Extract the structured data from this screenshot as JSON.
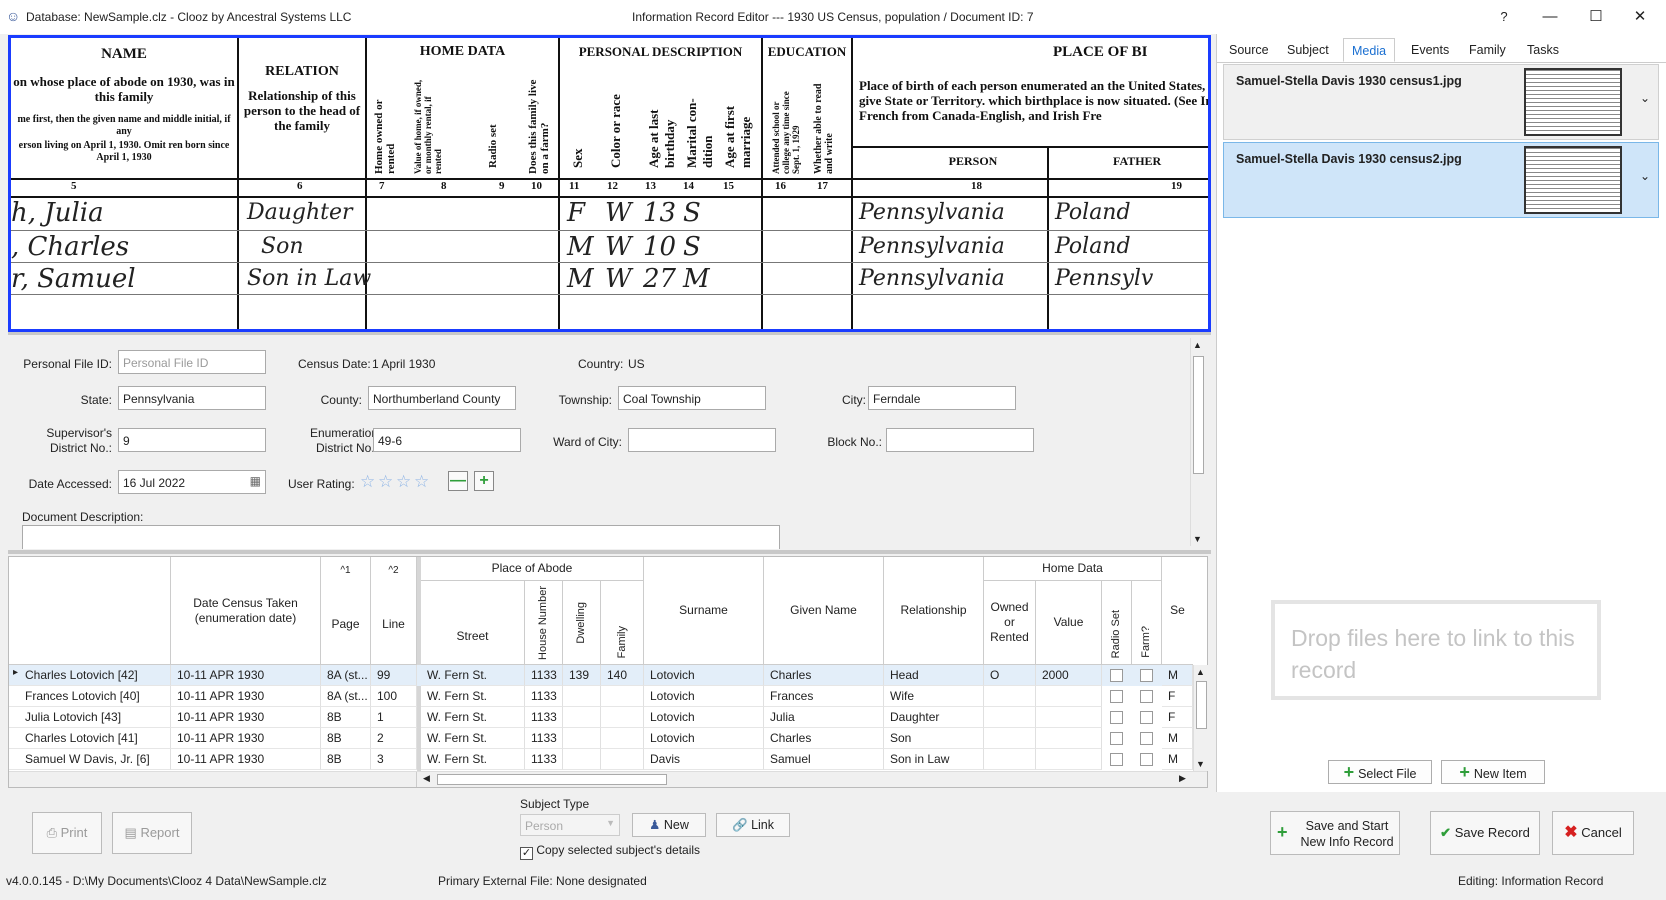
{
  "window": {
    "app_title": "Database: NewSample.clz - Clooz by Ancestral Systems LLC",
    "editor_title": "Information Record Editor --- 1930 US Census, population /  Document ID: 7",
    "help": "?",
    "minimize": "—",
    "maximize": "☐",
    "close": "✕"
  },
  "census_image": {
    "headers": [
      "NAME",
      "RELATION",
      "HOME DATA",
      "PERSONAL DESCRIPTION",
      "EDUCATION",
      "PLACE OF BI"
    ],
    "name_desc": "on whose place of abode on 1930, was in this family",
    "name_sub": "me first, then the given name and middle initial, if any",
    "name_sub2": "erson living on April 1, 1930. Omit ren born since April 1, 1930",
    "relation_desc": "Relationship of this person to the head of the family",
    "birth_desc": "Place of birth of each person enumerated an the United States, give State or Territory. which birthplace is now situated. (See In French from Canada-English, and Irish Fre",
    "home_cols": [
      "Home owned or rented",
      "Value of home, if owned, or monthly rental, if rented",
      "Radio set",
      "Does this family live on a farm?"
    ],
    "pd_cols": [
      "Sex",
      "Color or race",
      "Age at last birthday",
      "Marital con-dition",
      "Age at first marriage"
    ],
    "edu_cols": [
      "Attended school or college any time since Sept. 1, 1929",
      "Whether able to read and write"
    ],
    "person": "PERSON",
    "father": "FATHER",
    "col_nums": [
      "5",
      "6",
      "7",
      "8",
      "9",
      "10",
      "11",
      "12",
      "13",
      "14",
      "15",
      "16",
      "17",
      "18",
      "19"
    ],
    "hand_rows": [
      {
        "name": "h, Julia",
        "rel": "Daughter",
        "sex": "F",
        "race": "W",
        "age": "13",
        "mar": "S",
        "place": "Pennsylvania",
        "father": "Poland"
      },
      {
        "name": ", Charles",
        "rel": "Son",
        "sex": "M",
        "race": "W",
        "age": "10",
        "mar": "S",
        "place": "Pennsylvania",
        "father": "Poland"
      },
      {
        "name": "r, Samuel",
        "rel": "Son in Law",
        "sex": "M",
        "race": "W",
        "age": "27",
        "mar": "M",
        "place": "Pennsylvania",
        "father": "Pennsylv"
      }
    ]
  },
  "tabs": [
    "Source",
    "Subject",
    "Media",
    "Events",
    "Family",
    "Tasks"
  ],
  "media": [
    {
      "name": "Samuel-Stella Davis 1930 census1.jpg"
    },
    {
      "name": "Samuel-Stella Davis 1930 census2.jpg"
    }
  ],
  "drop_zone": "Drop files here to link to this record",
  "select_file": "Select File",
  "new_item": "New Item",
  "form": {
    "personal_file_id_label": "Personal File ID:",
    "personal_file_id_placeholder": "Personal File ID",
    "census_date_label": "Census Date:",
    "census_date": "1 April 1930",
    "country_label": "Country:",
    "country": "US",
    "state_label": "State:",
    "state": "Pennsylvania",
    "county_label": "County:",
    "county": "Northumberland County",
    "township_label": "Township:",
    "township": "Coal Township",
    "city_label": "City:",
    "city": "Ferndale",
    "supervisor_label": "Supervisor's District No.:",
    "supervisor": "9",
    "enum_label": "Enumeration District No.:",
    "enum": "49-6",
    "ward_label": "Ward of City:",
    "ward": "",
    "block_label": "Block No.:",
    "block": "",
    "date_accessed_label": "Date Accessed:",
    "date_accessed": "16 Jul 2022",
    "user_rating_label": "User Rating:",
    "user_rating": 0,
    "doc_desc_label": "Document Description:",
    "minus": "—",
    "plus": "+"
  },
  "grid": {
    "headers": {
      "date": "Date Census Taken (enumeration date)",
      "page": "Page",
      "line": "Line",
      "page_sort": "^1",
      "line_sort": "^2",
      "place_of_abode": "Place of Abode",
      "street": "Street",
      "house_number": "House Number",
      "dwelling": "Dwelling",
      "family": "Family",
      "surname": "Surname",
      "given_name": "Given Name",
      "relationship": "Relationship",
      "home_data": "Home Data",
      "owned": "Owned or Rented",
      "value": "Value",
      "radio": "Radio Set",
      "farm": "Farm?",
      "sex": "Se"
    },
    "rows": [
      {
        "subject": "Charles Lotovich  [42]",
        "date": "10-11 APR 1930",
        "page": "8A (st...",
        "line": "99",
        "street": "W. Fern St.",
        "house": "1133",
        "dwelling": "139",
        "family": "140",
        "surname": "Lotovich",
        "given": "Charles",
        "rel": "Head",
        "owned": "O",
        "value": "2000",
        "sex": "M"
      },
      {
        "subject": "Frances Lotovich  [40]",
        "date": "10-11 APR 1930",
        "page": "8A (st...",
        "line": "100",
        "street": "W. Fern St.",
        "house": "1133",
        "dwelling": "",
        "family": "",
        "surname": "Lotovich",
        "given": "Frances",
        "rel": "Wife",
        "owned": "",
        "value": "",
        "sex": "F"
      },
      {
        "subject": "Julia Lotovich  [43]",
        "date": "10-11 APR 1930",
        "page": "8B",
        "line": "1",
        "street": "W. Fern St.",
        "house": "1133",
        "dwelling": "",
        "family": "",
        "surname": "Lotovich",
        "given": "Julia",
        "rel": "Daughter",
        "owned": "",
        "value": "",
        "sex": "F"
      },
      {
        "subject": "Charles Lotovich  [41]",
        "date": "10-11 APR 1930",
        "page": "8B",
        "line": "2",
        "street": "W. Fern St.",
        "house": "1133",
        "dwelling": "",
        "family": "",
        "surname": "Lotovich",
        "given": "Charles",
        "rel": "Son",
        "owned": "",
        "value": "",
        "sex": "M"
      },
      {
        "subject": "Samuel W Davis, Jr.  [6]",
        "date": "10-11 APR 1930",
        "page": "8B",
        "line": "3",
        "street": "W. Fern St.",
        "house": "1133",
        "dwelling": "",
        "family": "",
        "surname": "Davis",
        "given": "Samuel",
        "rel": "Son in Law",
        "owned": "",
        "value": "",
        "sex": "M"
      }
    ]
  },
  "bottom": {
    "print": "Print",
    "report": "Report",
    "subject_type_label": "Subject Type",
    "subject_type": "Person",
    "new": "New",
    "link": "Link",
    "copy_details": "Copy selected subject's details",
    "save_start_1": "Save and Start",
    "save_start_2": "New Info Record",
    "save_record": "Save Record",
    "cancel": "Cancel"
  },
  "status": {
    "version_path": "v4.0.0.145  -  D:\\My Documents\\Clooz 4 Data\\NewSample.clz",
    "primary_external": "Primary External File: None designated",
    "editing": "Editing: Information Record"
  },
  "colors": {
    "accent": "#1a6fd1",
    "selection": "#cfe5f9",
    "add_green": "#2f9e3a",
    "cancel_red": "#d62020",
    "image_border": "#1a3cff"
  }
}
